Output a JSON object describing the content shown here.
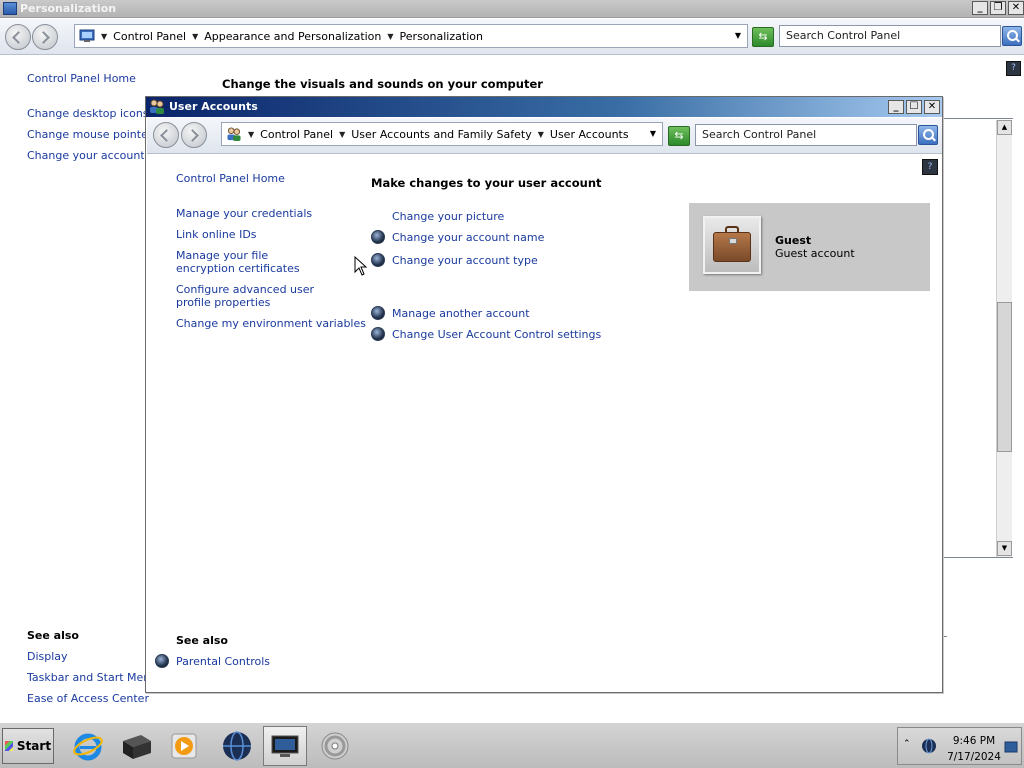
{
  "background_window": {
    "title": "Personalization",
    "address_bar": {
      "crumbs": [
        "Control Panel",
        "Appearance and Personalization",
        "Personalization"
      ]
    },
    "search_placeholder": "Search Control Panel",
    "left_nav": {
      "home": "Control Panel Home",
      "items": [
        "Change desktop icons",
        "Change mouse pointers",
        "Change your account pic"
      ]
    },
    "heading": "Change the visuals and sounds on your computer",
    "see_also": {
      "title": "See also",
      "items": [
        "Display",
        "Taskbar and Start Menu",
        "Ease of Access Center"
      ]
    }
  },
  "user_accounts_window": {
    "title": "User Accounts",
    "address_bar": {
      "crumbs": [
        "Control Panel",
        "User Accounts and Family Safety",
        "User Accounts"
      ]
    },
    "search_placeholder": "Search Control Panel",
    "left_nav": {
      "home": "Control Panel Home",
      "items": [
        "Manage your credentials",
        "Link online IDs",
        "Manage your file encryption certificates",
        "Configure advanced user profile properties",
        "Change my environment variables"
      ]
    },
    "heading": "Make changes to your user account",
    "tasks": [
      "Change your picture",
      "Change your account name",
      "Change your account type",
      "Manage another account",
      "Change User Account Control settings"
    ],
    "account": {
      "name": "Guest",
      "type": "Guest account"
    },
    "see_also": {
      "title": "See also",
      "items": [
        "Parental Controls"
      ]
    }
  },
  "taskbar": {
    "start_label": "Start",
    "apps": [
      "internet-explorer-icon",
      "server-manager-icon",
      "media-player-icon",
      "network-globe-icon",
      "control-panel-icon",
      "disc-icon"
    ],
    "clock_time": "9:46 PM",
    "clock_date": "7/17/2024"
  }
}
